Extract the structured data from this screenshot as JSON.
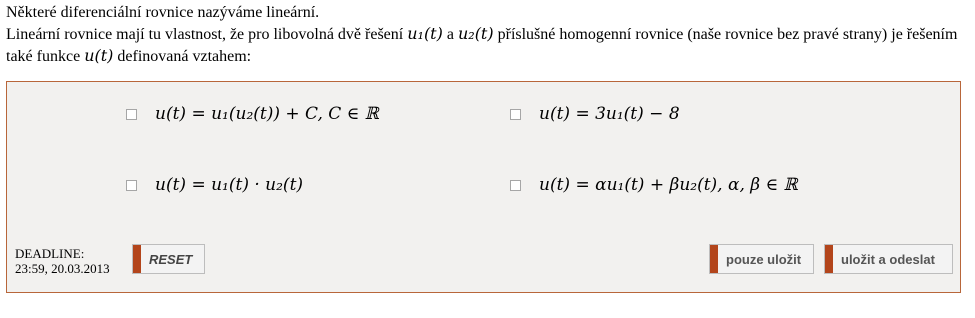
{
  "intro": {
    "line1": "Některé diferenciální rovnice nazýváme lineární.",
    "line2_a": "Lineární rovnice mají tu vlastnost, že pro libovolná dvě řešení ",
    "u1": "u₁(t)",
    "and": " a ",
    "u2": "u₂(t)",
    "line2_b": " příslušné homogenní rovnice (naše rovnice bez pravé strany) je řešením také funkce ",
    "u": "u(t)",
    "line2_c": " definovaná vztahem:"
  },
  "options": [
    "u(t) = u₁(u₂(t)) + C,    C ∈ ℝ",
    "u(t) = 3u₁(t) − 8",
    "u(t) = u₁(t) · u₂(t)",
    "u(t) = αu₁(t) + βu₂(t),    α, β ∈ ℝ"
  ],
  "deadline": {
    "label": "DEADLINE:",
    "value": "23:59, 20.03.2013"
  },
  "buttons": {
    "reset": "RESET",
    "save": "pouze uložit",
    "save_send": "uložit a odeslat"
  },
  "colors": {
    "border": "#b8663a",
    "button_accent": "#b3451b",
    "panel_bg": "#f2f1ef"
  }
}
